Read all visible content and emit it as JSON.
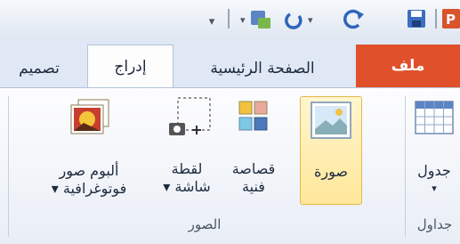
{
  "qat": {
    "dropdown_arrow": "▾",
    "more_icon": "qat-customize-icon",
    "buttons": [
      "redo-icon",
      "undo-icon",
      "save-icon",
      "powerpoint-icon"
    ]
  },
  "tabs": {
    "file": "ملف",
    "home": "الصفحة الرئيسية",
    "insert": "إدراج",
    "design": "تصميم"
  },
  "ribbon": {
    "tables_group": {
      "label": "جداول",
      "table_button": "جدول",
      "table_arrow": "▾"
    },
    "images_group": {
      "label": "الصور",
      "picture": "صورة",
      "clipart_line1": "قصاصة",
      "clipart_line2": "فنية",
      "screenshot_line1": "لقطة",
      "screenshot_line2": "شاشة ▾",
      "album_line1": "ألبوم صور",
      "album_line2": "فوتوغرافية ▾"
    }
  },
  "colors": {
    "file_tab": "#e0502b",
    "highlight": "#ffe79a",
    "ribbon_bg": "#fdfdfe"
  }
}
